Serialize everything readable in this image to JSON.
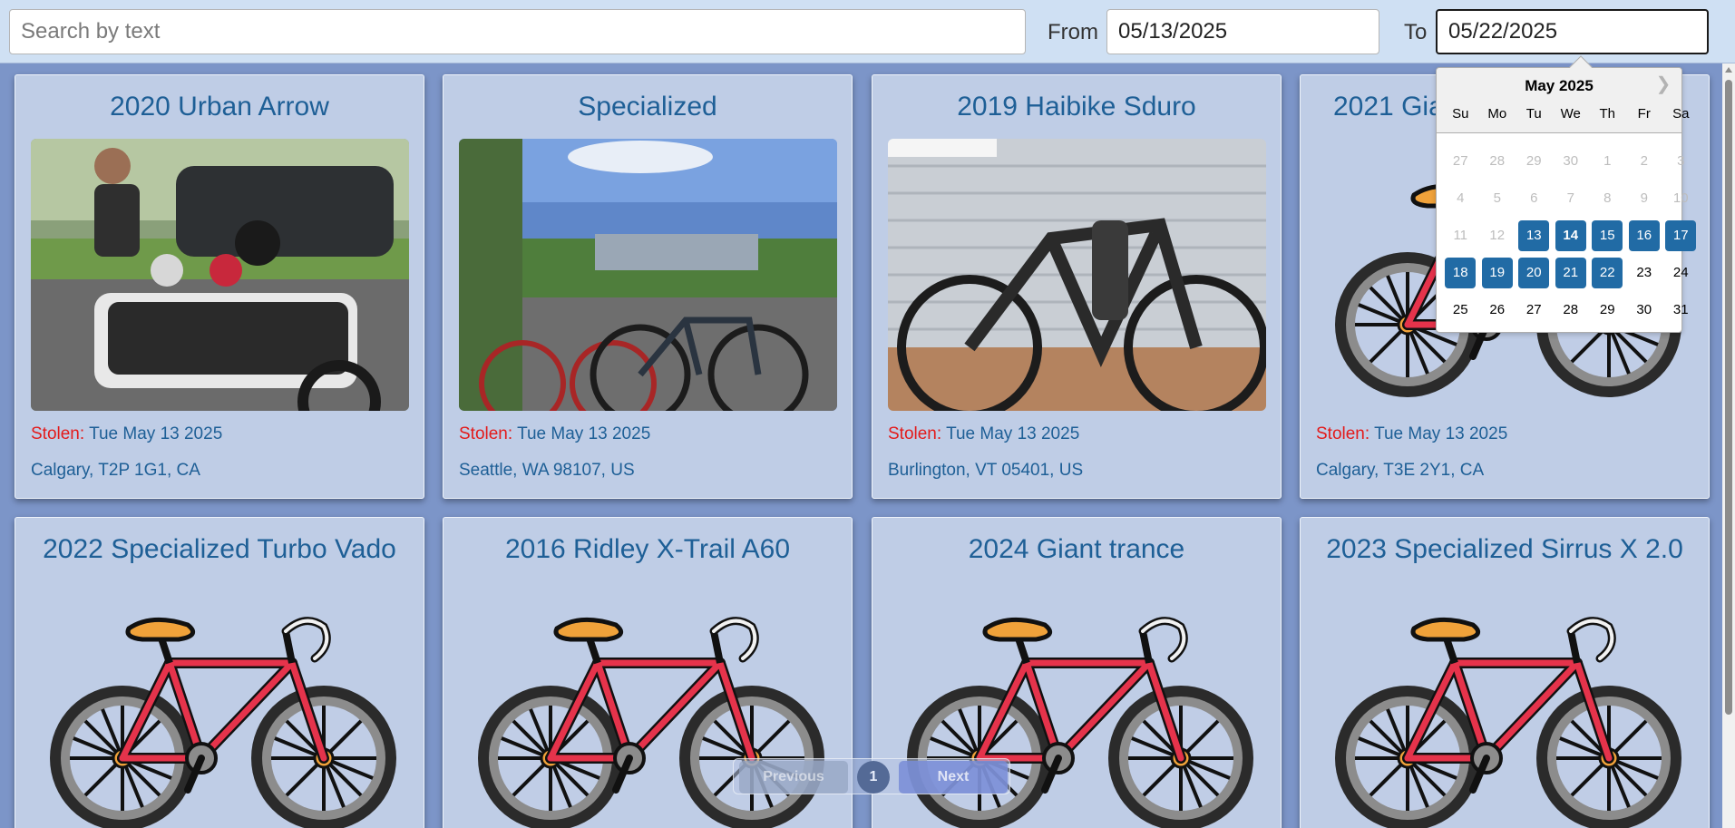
{
  "filters": {
    "search_placeholder": "Search by text",
    "search_value": "",
    "from_label": "From",
    "from_value": "05/13/2025",
    "to_label": "To",
    "to_value": "05/22/2025"
  },
  "cards": [
    {
      "title": "2020 Urban Arrow",
      "stolen_label": "Stolen:",
      "stolen_date": "Tue May 13 2025",
      "location": "Calgary, T2P 1G1, CA",
      "image": "photo-cargo-bike"
    },
    {
      "title": "Specialized",
      "stolen_label": "Stolen:",
      "stolen_date": "Tue May 13 2025",
      "location": "Seattle, WA 98107, US",
      "image": "photo-bikes-waterfront"
    },
    {
      "title": "2019 Haibike Sduro",
      "stolen_label": "Stolen:",
      "stolen_date": "Tue May 13 2025",
      "location": "Burlington, VT 05401, US",
      "image": "photo-emtb"
    },
    {
      "title": "2021 Gia",
      "stolen_label": "Stolen:",
      "stolen_date": "Tue May 13 2025",
      "location": "Calgary, T3E 2Y1, CA",
      "image": "bike-placeholder-icon"
    },
    {
      "title": "2022 Specialized Turbo Vado",
      "image": "bike-placeholder-icon"
    },
    {
      "title": "2016 Ridley X-Trail A60",
      "image": "bike-placeholder-icon"
    },
    {
      "title": "2024 Giant trance",
      "image": "bike-placeholder-icon"
    },
    {
      "title": "2023 Specialized Sirrus X 2.0",
      "image": "bike-placeholder-icon"
    }
  ],
  "datepicker": {
    "month": "May 2025",
    "next_icon": "chevron-right-icon",
    "days_of_week": [
      "Su",
      "Mo",
      "Tu",
      "We",
      "Th",
      "Fr",
      "Sa"
    ],
    "weeks": [
      [
        "27",
        "28",
        "29",
        "30",
        "1",
        "2",
        "3"
      ],
      [
        "4",
        "5",
        "6",
        "7",
        "8",
        "9",
        "10"
      ],
      [
        "11",
        "12",
        "13",
        "14",
        "15",
        "16",
        "17"
      ],
      [
        "18",
        "19",
        "20",
        "21",
        "22",
        "23",
        "24"
      ],
      [
        "25",
        "26",
        "27",
        "28",
        "29",
        "30",
        "31"
      ]
    ],
    "muted_days": [
      "27",
      "28",
      "29",
      "30",
      "1",
      "2",
      "3",
      "4",
      "5",
      "6",
      "7",
      "8",
      "9",
      "10",
      "11",
      "12"
    ],
    "selected_range": [
      "13",
      "14",
      "15",
      "16",
      "17",
      "18",
      "19",
      "20",
      "21",
      "22"
    ],
    "today": "14",
    "selected_color": "#216ba5"
  },
  "pagination": {
    "previous_label": "Previous",
    "page": "1",
    "next_label": "Next"
  },
  "colors": {
    "title": "#1e5f96",
    "stolen": "#e31b1b",
    "card_bg": "#bfcde6",
    "page_bg": "#7c95c8"
  }
}
